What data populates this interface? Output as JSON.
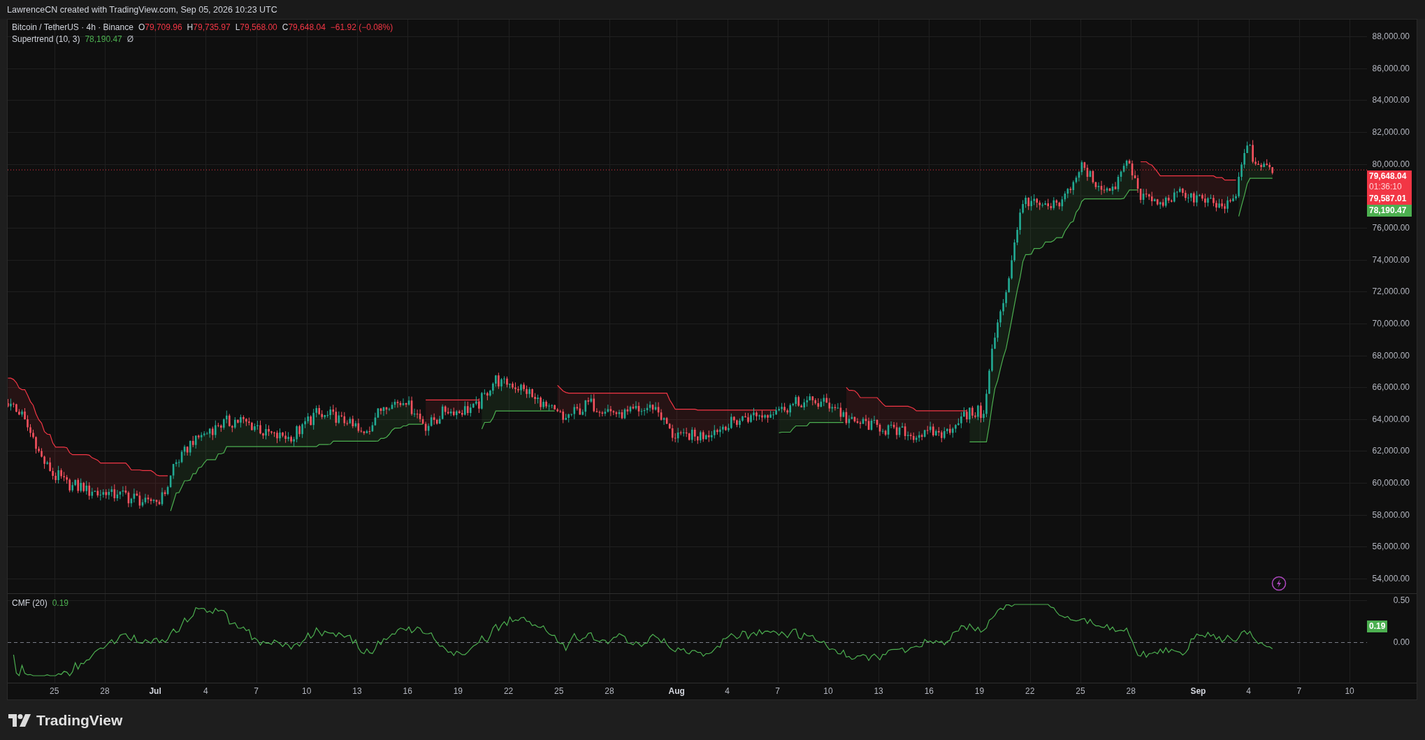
{
  "header": {
    "text": "LawrenceCN created with TradingView.com, Sep 05, 2026 10:23 UTC"
  },
  "legend": {
    "symbol": "Bitcoin / TetherUS · 4h · Binance",
    "ohlc": [
      {
        "label": "O",
        "value": "79,709.96"
      },
      {
        "label": "H",
        "value": "79,735.97"
      },
      {
        "label": "L",
        "value": "79,568.00"
      },
      {
        "label": "C",
        "value": "79,648.04"
      }
    ],
    "change": "−61.92 (−0.08%)",
    "indicator": {
      "name": "Supertrend (10, 3)",
      "value": "78,190.47",
      "toggle": "Ø"
    }
  },
  "price_axis": {
    "ticks_upper": [
      "88,000.00",
      "86,000.00",
      "84,000.00",
      "82,000.00",
      "80,000.00"
    ],
    "ticks_lower": [
      "76,000.00",
      "74,000.00",
      "72,000.00",
      "70,000.00",
      "68,000.00",
      "66,000.00",
      "64,000.00",
      "62,000.00",
      "60,000.00",
      "58,000.00",
      "56,000.00",
      "54,000.00"
    ]
  },
  "price_badges": [
    {
      "kind": "last",
      "value": "79,648.04",
      "countdown": "01:36:10",
      "color": "#f23645"
    },
    {
      "kind": "price",
      "value": "79,587.01",
      "color": "#f23645"
    },
    {
      "kind": "price",
      "value": "78,190.47",
      "color": "#4caf50"
    }
  ],
  "cmf": {
    "name": "CMF (20)",
    "value": "0.19",
    "ticks": [
      "0.50",
      "0.00"
    ],
    "badge": "0.19"
  },
  "time_axis": {
    "labels": [
      {
        "text": "25",
        "kind": "day"
      },
      {
        "text": "28",
        "kind": "day"
      },
      {
        "text": "Jul",
        "kind": "month"
      },
      {
        "text": "4",
        "kind": "day"
      },
      {
        "text": "7",
        "kind": "day"
      },
      {
        "text": "10",
        "kind": "day"
      },
      {
        "text": "13",
        "kind": "day"
      },
      {
        "text": "16",
        "kind": "day"
      },
      {
        "text": "19",
        "kind": "day"
      },
      {
        "text": "22",
        "kind": "day"
      },
      {
        "text": "25",
        "kind": "day"
      },
      {
        "text": "28",
        "kind": "day"
      },
      {
        "text": "Aug",
        "kind": "month"
      },
      {
        "text": "4",
        "kind": "day"
      },
      {
        "text": "7",
        "kind": "day"
      },
      {
        "text": "10",
        "kind": "day"
      },
      {
        "text": "13",
        "kind": "day"
      },
      {
        "text": "16",
        "kind": "day"
      },
      {
        "text": "19",
        "kind": "day"
      },
      {
        "text": "22",
        "kind": "day"
      },
      {
        "text": "25",
        "kind": "day"
      },
      {
        "text": "28",
        "kind": "day"
      },
      {
        "text": "Sep",
        "kind": "month"
      },
      {
        "text": "4",
        "kind": "day"
      },
      {
        "text": "7",
        "kind": "day"
      },
      {
        "text": "10",
        "kind": "day"
      }
    ]
  },
  "logo": {
    "text": "TradingView"
  }
}
